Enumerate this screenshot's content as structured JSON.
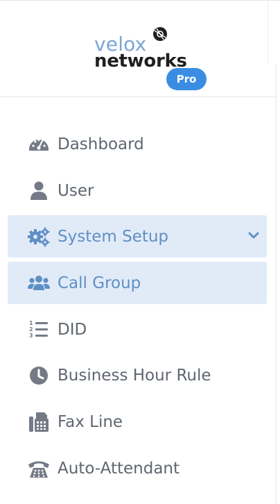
{
  "brand": {
    "name_top": "velox",
    "name_bottom": "networks",
    "badge": "Pro"
  },
  "nav": {
    "items": [
      {
        "label": "Dashboard",
        "icon": "dashboard-gauge-icon"
      },
      {
        "label": "User",
        "icon": "user-icon"
      },
      {
        "label": "System Setup",
        "icon": "cogs-icon",
        "expanded": true
      },
      {
        "label": "Call Group",
        "icon": "users-group-icon"
      },
      {
        "label": "DID",
        "icon": "numbered-list-icon"
      },
      {
        "label": "Business Hour Rule",
        "icon": "clock-icon"
      },
      {
        "label": "Fax Line",
        "icon": "fax-icon"
      },
      {
        "label": "Auto-Attendant",
        "icon": "phone-attendant-icon"
      }
    ]
  },
  "colors": {
    "active_bg": "#e1ebf8",
    "active_text": "#5f8fc4",
    "text": "#5f6670",
    "icon": "#747b87",
    "badge": "#3a8de3",
    "logo_blue": "#7aa6d3"
  }
}
